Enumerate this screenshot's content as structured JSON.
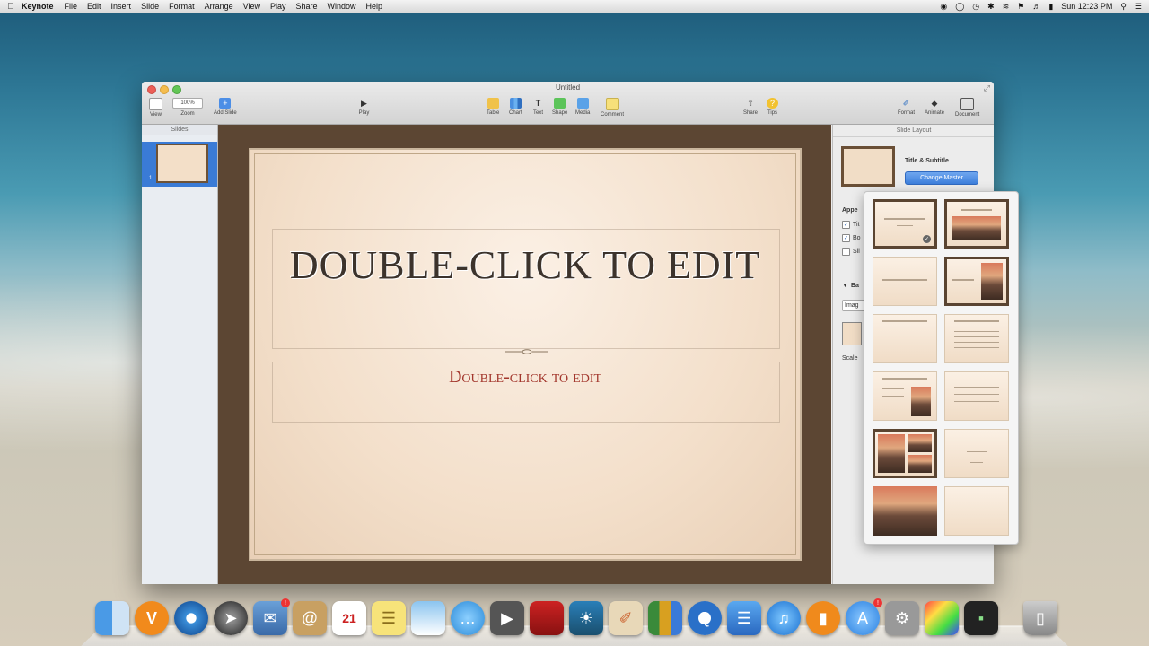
{
  "menubar": {
    "app_name": "Keynote",
    "items": [
      "File",
      "Edit",
      "Insert",
      "Slide",
      "Format",
      "Arrange",
      "View",
      "Play",
      "Share",
      "Window",
      "Help"
    ],
    "clock": "Sun 12:23 PM"
  },
  "window": {
    "title": "Untitled",
    "toolbar": {
      "view": "View",
      "zoom_value": "100%",
      "zoom": "Zoom",
      "add_slide": "Add Slide",
      "play": "Play",
      "table": "Table",
      "chart": "Chart",
      "text": "Text",
      "shape": "Shape",
      "media": "Media",
      "comment": "Comment",
      "share": "Share",
      "tips": "Tips",
      "format": "Format",
      "animate": "Animate",
      "document": "Document"
    }
  },
  "slides_pane": {
    "header": "Slides",
    "selected_slide_number": "1"
  },
  "slide": {
    "title": "DOUBLE-CLICK TO EDIT",
    "subtitle": "Double-click to edit"
  },
  "inspector": {
    "header": "Slide Layout",
    "layout_name": "Title & Subtitle",
    "change_master": "Change Master",
    "appearance_label": "Appe",
    "opt1": "Tit",
    "opt2": "Bo",
    "opt3": "Sli",
    "background_label": "Ba",
    "image_label": "Imag",
    "scale_label": "Scale"
  },
  "dock": {
    "calendar_day": "21"
  },
  "colors": {
    "accent_blue": "#3a7bd6",
    "slide_title": "#3c332c",
    "slide_subtitle": "#a3372d",
    "frame_brown": "#5c4633"
  }
}
